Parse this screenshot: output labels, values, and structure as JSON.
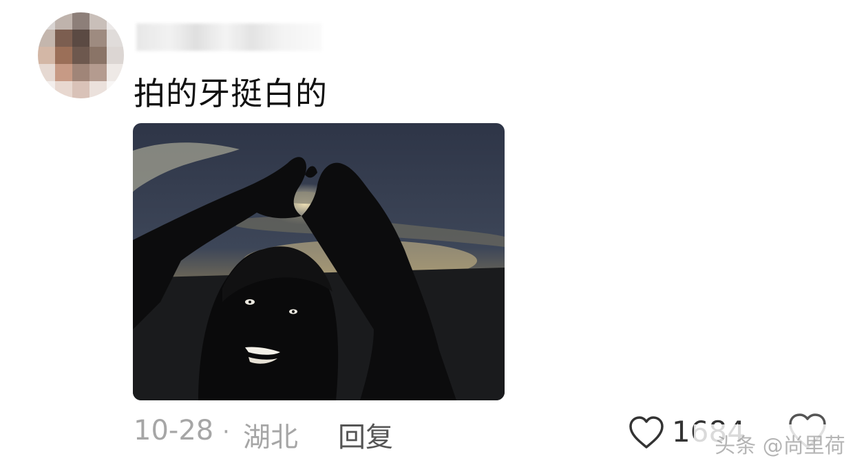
{
  "comment": {
    "text": "拍的牙挺白的",
    "date": "10-28",
    "separator": "·",
    "location": "湖北",
    "reply_label": "回复",
    "like_count": "1684",
    "photo_icon": "photo-heart-hands-image"
  },
  "watermark": {
    "text": "头条 @尚里荷"
  },
  "colors": {
    "meta_gray": "#a6a6a6",
    "text_dark": "#111111",
    "photo_sky": "#3a4150"
  },
  "icons": {
    "like": "heart-outline-icon",
    "reaction": "reaction-heart-icon"
  }
}
